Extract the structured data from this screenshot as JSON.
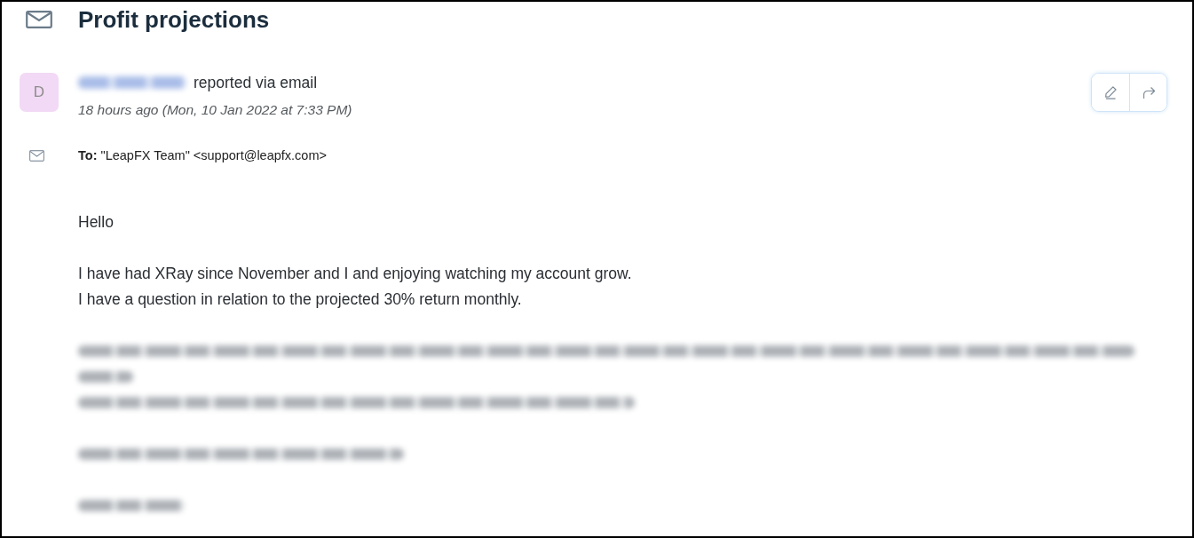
{
  "header": {
    "title": "Profit projections"
  },
  "message": {
    "avatar": {
      "initial": "D"
    },
    "sender": {
      "kind": "blurred"
    },
    "action": "reported via email",
    "timestamp": "18 hours ago (Mon, 10 Jan 2022 at 7:33 PM)",
    "actions": [
      {
        "kind": "edit"
      },
      {
        "kind": "forward"
      }
    ]
  },
  "recipient": {
    "text": "**To:** \"LeapFX Team\" <support@leapfx.com>"
  },
  "body": [
    [
      {
        "kind": "text",
        "text": "Hello"
      }
    ],
    [
      {
        "kind": "text",
        "text": "I have had XRay since November and I and enjoying watching my account grow."
      },
      {
        "kind": "text",
        "text": "I have a question in relation to the projected 30% return monthly."
      }
    ],
    [
      {
        "kind": "blurred"
      },
      {
        "kind": "blurred"
      },
      {
        "kind": "blurred"
      }
    ],
    [
      {
        "kind": "blurred"
      }
    ],
    [
      {
        "kind": "blurred"
      }
    ]
  ]
}
